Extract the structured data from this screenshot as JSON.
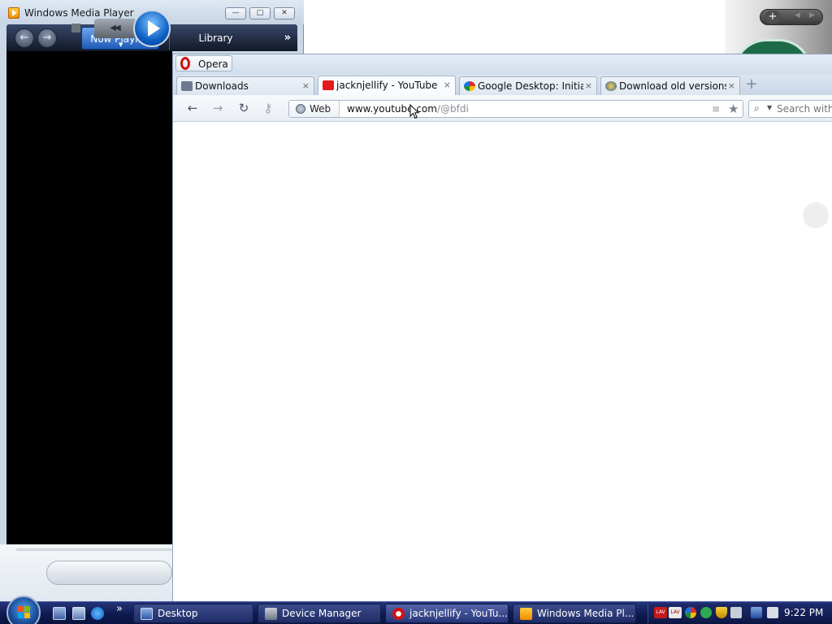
{
  "wmp": {
    "title": "Windows Media Player",
    "minimize": "—",
    "maximize": "□",
    "close": "✕",
    "back": "←",
    "forward": "→",
    "tab_now_playing": "Now Playing",
    "tab_library": "Library",
    "more": "»",
    "prev": "◀◀",
    "chevron": "▼"
  },
  "opera": {
    "menu_label": "Opera",
    "tabs": [
      {
        "label": "Downloads",
        "close": "×"
      },
      {
        "label": "jacknjellify - YouTube",
        "close": "×"
      },
      {
        "label": "Google Desktop: Initial ...",
        "close": "×"
      },
      {
        "label": "Download old versions ...",
        "close": "×"
      }
    ],
    "new_tab": "+",
    "nav": {
      "back": "←",
      "forward": "→",
      "reload": "↻",
      "key": "⚷"
    },
    "address": {
      "web_label": "Web",
      "url_host": "www.youtube.com",
      "url_path": "/@bfdi",
      "rss": "≡",
      "star": "★"
    },
    "search": {
      "placeholder": "Search with",
      "icon": "⌕",
      "dropdown": "▼"
    }
  },
  "gadget": {
    "plus": "+",
    "prev": "◀",
    "next": "▶"
  },
  "taskbar": {
    "quicklaunch_more": "»",
    "buttons": [
      {
        "label": "Desktop"
      },
      {
        "label": "Device Manager"
      },
      {
        "label": "jacknjellify - YouTu..."
      },
      {
        "label": "Windows Media Pl..."
      }
    ],
    "tray_icons": [
      "LAV",
      "LAV"
    ],
    "clock": "9:22 PM"
  },
  "colors": {
    "taskbar": "#0e1a4f",
    "wmp_video": "#000000",
    "wmp_tab_active": "#1e5bb8",
    "opera_brand": "#d01212"
  }
}
